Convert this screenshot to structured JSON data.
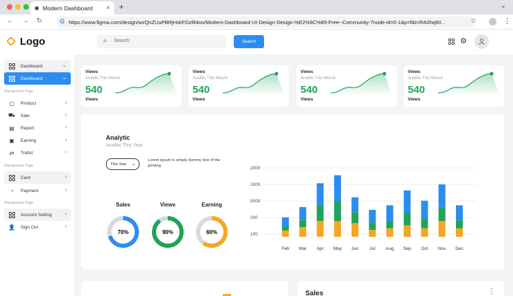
{
  "browser": {
    "tab_title": "Modern Dashboard",
    "tab_close": "×",
    "new_tab": "+",
    "tab_menu": "⌄",
    "back": "←",
    "forward": "→",
    "reload": "↻",
    "url": "https://www.figma.com/design/wzQnZUuPBRjHskFDzf84oo/Modern-Dashboard-UI-Design-Design-%E2%9C%85-Free--Community-?node-id=0-1&p=f&t=RA0hq90...",
    "traffic_colors": [
      "#ff5f57",
      "#febc2e",
      "#28c840"
    ]
  },
  "app": {
    "logo_text": "Logo",
    "search_placeholder": "Search",
    "search_button": "Search",
    "accent": "#2d8cf0",
    "green": "#20a35a",
    "orange": "#f5a623"
  },
  "sidebar": {
    "top_items": [
      {
        "label": "Dashboard",
        "icon": "grid-icon",
        "style": "boxed",
        "chev": "⌄"
      },
      {
        "label": "Dashboard",
        "icon": "grid-icon",
        "style": "active",
        "chev": "⌄"
      }
    ],
    "sections": [
      {
        "title": "Management Page",
        "items": [
          {
            "label": "Product",
            "icon": "bag-icon",
            "glyph": "▢"
          },
          {
            "label": "Sale",
            "icon": "cart-icon",
            "glyph": "⛟"
          },
          {
            "label": "Report",
            "icon": "report-icon",
            "glyph": "▤"
          },
          {
            "label": "Earning",
            "icon": "earning-icon",
            "glyph": "▣"
          },
          {
            "label": "Trafict",
            "icon": "traffic-icon",
            "glyph": "⇄"
          }
        ]
      },
      {
        "title": "Management Page",
        "items": [
          {
            "label": "Card",
            "icon": "grid-icon",
            "glyph": "",
            "style": "boxed"
          },
          {
            "label": "Payment",
            "icon": "payment-icon",
            "glyph": "◔"
          }
        ]
      },
      {
        "title": "Management Page",
        "items": [
          {
            "label": "Account Setting",
            "icon": "grid-icon",
            "glyph": "",
            "style": "boxed"
          },
          {
            "label": "Sign Out",
            "icon": "user-icon",
            "glyph": "👤"
          }
        ]
      }
    ]
  },
  "stats": [
    {
      "title": "Views",
      "subtitle": "Analitic This Mount",
      "value": "540",
      "footer": "Views"
    },
    {
      "title": "Views",
      "subtitle": "Analitic This Mount",
      "value": "540",
      "footer": "Views"
    },
    {
      "title": "Views",
      "subtitle": "Analitic This Mount",
      "value": "540",
      "footer": "Views"
    },
    {
      "title": "Views",
      "subtitle": "Analitic This Mount",
      "value": "540",
      "footer": "Views"
    }
  ],
  "analytic": {
    "title": "Analytic",
    "subtitle": "Analitic This Year",
    "select_value": "This Year",
    "lorem": "Lorem ipsum is simply dummy text of the printing",
    "rings": [
      {
        "label": "Sales",
        "percent": 70,
        "text": "70%",
        "color": "#2d8cf0"
      },
      {
        "label": "Views",
        "percent": 90,
        "text": "90%",
        "color": "#20a35a"
      },
      {
        "label": "Earning",
        "percent": 60,
        "text": "60%",
        "color": "#f5a623"
      }
    ]
  },
  "chart_data": {
    "type": "bar",
    "stacked": true,
    "categories": [
      "Feb",
      "Mar",
      "Apr",
      "May",
      "Jun",
      "Jul",
      "Aug",
      "Sep",
      "Oct",
      "Nov",
      "Dec"
    ],
    "y_tick_labels": [
      "100",
      "200",
      "5000",
      "1000",
      "2000"
    ],
    "grid": true,
    "series": [
      {
        "color": "#f5a623",
        "values": [
          0.22,
          0.34,
          0.55,
          0.55,
          0.48,
          0.24,
          0.3,
          0.4,
          0.3,
          0.55,
          0.3
        ]
      },
      {
        "color": "#20a35a",
        "values": [
          0.14,
          0.24,
          0.54,
          0.7,
          0.38,
          0.26,
          0.24,
          0.44,
          0.34,
          0.48,
          0.28
        ]
      },
      {
        "color": "#2d8cf0",
        "values": [
          0.32,
          0.46,
          0.78,
          0.9,
          0.52,
          0.44,
          0.56,
          0.78,
          0.62,
          0.8,
          0.52
        ]
      }
    ],
    "ylim": [
      0,
      2.5
    ]
  },
  "bottom": {
    "sales_title": "Sales",
    "more": "⋮"
  }
}
